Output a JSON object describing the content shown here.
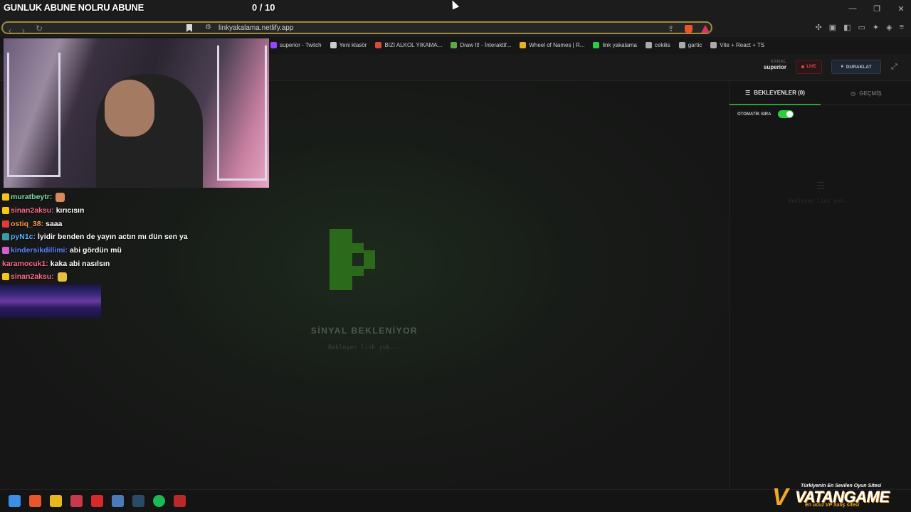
{
  "overlay": {
    "title": "GUNLUK ABUNE NOLRU ABUNE",
    "counter": "0 / 10"
  },
  "browser": {
    "url": "linkyakalama.netlify.app",
    "bookmarks": [
      {
        "label": "superior - Twitch",
        "icon_color": "#9146ff"
      },
      {
        "label": "Yeni klasör",
        "icon_color": "#cccccc"
      },
      {
        "label": "BIZI ALKOL YIKAMA...",
        "icon_color": "#d84a3a"
      },
      {
        "label": "Draw It! - İnteraktif...",
        "icon_color": "#5aa84a"
      },
      {
        "label": "Wheel of Names | R...",
        "icon_color": "#e8b020"
      },
      {
        "label": "link yakalama",
        "icon_color": "#2ecc40"
      },
      {
        "label": "cekilis",
        "icon_color": "#aaaaaa"
      },
      {
        "label": "gartic",
        "icon_color": "#aaaaaa"
      },
      {
        "label": "Vite + React + TS",
        "icon_color": "#aaaaaa"
      }
    ]
  },
  "header": {
    "kanal_label": "KANAL",
    "kanal_value": "superior",
    "live_label": "LIVE",
    "pause_label": "DURAKLAT"
  },
  "main": {
    "signal_title": "SİNYAL BEKLENİYOR",
    "signal_sub": "Bekleyen link yok..."
  },
  "panel": {
    "tab_waiting": "BEKLEYENLER (0)",
    "tab_history": "GEÇMİŞ",
    "auto_label": "OTOMATİK SIRA",
    "auto_enabled": true,
    "empty_text": "Bekleyen link yok..."
  },
  "chat": [
    {
      "user": "muratbeytr:",
      "message": "",
      "name_color": "#7fe0a8",
      "badge_color": "#f5c518",
      "emote_color": "#d98a5a"
    },
    {
      "user": "sinan2aksu:",
      "message": "kırıcısın",
      "name_color": "#ff6b8a",
      "badge_color": "#f5c518",
      "emote_color": ""
    },
    {
      "user": "ostiq_38:",
      "message": "saaa",
      "name_color": "#ff9a4a",
      "badge_color": "#e03a3a",
      "emote_color": ""
    },
    {
      "user": "pyN1c:",
      "message": "İyidir benden de yayın actın mı dün sen ya",
      "name_color": "#5ab0ff",
      "badge_color": "#3a9aa0",
      "emote_color": ""
    },
    {
      "user": "kindersikdillimi:",
      "message": "abi gördün mü",
      "name_color": "#5a8aff",
      "badge_color": "#d060d0",
      "emote_color": ""
    },
    {
      "user": "karamocuk1:",
      "message": "kaka abi nasılsın",
      "name_color": "#ff6b8a",
      "badge_color": "",
      "emote_color": ""
    },
    {
      "user": "sinan2aksu:",
      "message": "",
      "name_color": "#ff6b8a",
      "badge_color": "#f5c518",
      "emote_color": "#e8c040"
    }
  ],
  "sponsor": {
    "tagline": "Türkiyenin En Sevilen Oyun Sitesi",
    "brand": "VATANGAME",
    "sub": "En ucuz VP Satış sitesi"
  },
  "colors": {
    "accent_green": "#2ea043",
    "live_red": "#e04848",
    "url_border": "#a08a3a"
  }
}
